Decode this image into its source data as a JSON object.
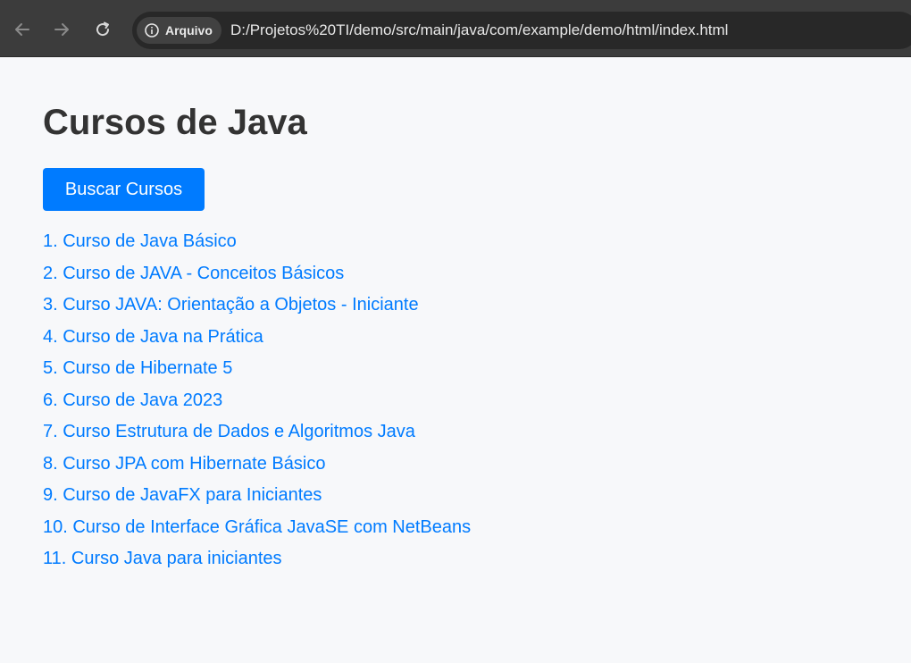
{
  "browser": {
    "chip_label": "Arquivo",
    "url": "D:/Projetos%20TI/demo/src/main/java/com/example/demo/html/index.html",
    "icons": {
      "back": "arrow-left-icon",
      "forward": "arrow-right-icon",
      "reload": "reload-icon",
      "info": "info-icon"
    }
  },
  "page": {
    "title": "Cursos de Java",
    "search_button_label": "Buscar Cursos",
    "courses": [
      "1. Curso de Java Básico",
      "2. Curso de JAVA - Conceitos Básicos",
      "3. Curso JAVA: Orientação a Objetos - Iniciante",
      "4. Curso de Java na Prática",
      "5. Curso de Hibernate 5",
      "6. Curso de Java 2023",
      "7. Curso Estrutura de Dados e Algoritmos Java",
      "8. Curso JPA com Hibernate Básico",
      "9. Curso de JavaFX para Iniciantes",
      "10. Curso de Interface Gráfica JavaSE com NetBeans",
      "11. Curso Java para iniciantes"
    ]
  },
  "colors": {
    "accent": "#007bff",
    "title": "#333333",
    "background": "#f7f8fa",
    "browser_bar": "#3c3c3c"
  }
}
